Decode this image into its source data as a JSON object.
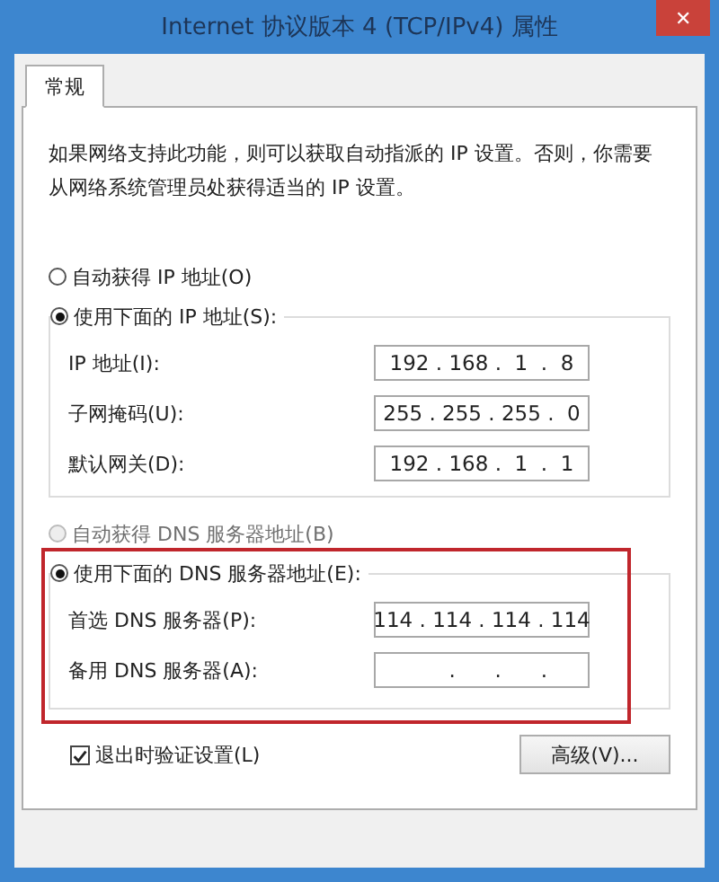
{
  "window": {
    "title": "Internet 协议版本 4 (TCP/IPv4) 属性",
    "close": "✕"
  },
  "tabs": [
    {
      "label": "常规",
      "selected": true
    }
  ],
  "description": "如果网络支持此功能，则可以获取自动指派的 IP 设置。否则，你需要从网络系统管理员处获得适当的 IP 设置。",
  "ip": {
    "options": [
      {
        "label": "自动获得 IP 地址(O)",
        "selected": false,
        "disabled": false
      },
      {
        "label": "使用下面的 IP 地址(S):",
        "selected": true,
        "disabled": false
      }
    ],
    "fields": [
      {
        "label": "IP 地址(I):",
        "value": "192 . 168 .  1  .  8"
      },
      {
        "label": "子网掩码(U):",
        "value": "255 . 255 . 255 .  0"
      },
      {
        "label": "默认网关(D):",
        "value": "192 . 168 .  1  .  1"
      }
    ]
  },
  "dns": {
    "highlighted": true,
    "options": [
      {
        "label": "自动获得 DNS 服务器地址(B)",
        "selected": false,
        "disabled": true
      },
      {
        "label": "使用下面的 DNS 服务器地址(E):",
        "selected": true,
        "disabled": false
      }
    ],
    "fields": [
      {
        "label": "首选 DNS 服务器(P):",
        "value": "114 . 114 . 114 . 114"
      },
      {
        "label": "备用 DNS 服务器(A):",
        "value": "     .      .      ."
      }
    ]
  },
  "validate": {
    "label": "退出时验证设置(L)",
    "checked": true
  },
  "advanced_button": "高级(V)..."
}
